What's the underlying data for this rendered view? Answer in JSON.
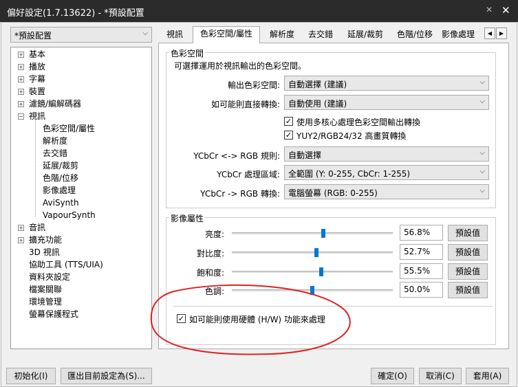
{
  "window": {
    "title": "偏好設定(1.7.13622) - *預設配置"
  },
  "profile": {
    "value": "*預設配置"
  },
  "tree": {
    "items": [
      "基本",
      "播放",
      "字幕",
      "裝置",
      "濾鏡/編解碼器",
      "視訊",
      "色彩空間/屬性",
      "解析度",
      "去交錯",
      "延展/裁剪",
      "色階/位移",
      "影像處理",
      "AviSynth",
      "VapourSynth",
      "音訊",
      "擴充功能",
      "3D 視訊",
      "協助工具 (TTS/UIA)",
      "資料夾設定",
      "檔案關聯",
      "環境管理",
      "螢幕保護程式"
    ]
  },
  "tabs": [
    "視訊",
    "色彩空間/屬性",
    "解析度",
    "去交錯",
    "延展/裁剪",
    "色階/位移",
    "影像處理"
  ],
  "colorspace": {
    "title": "色彩空間",
    "desc": "可選擇運用於視訊輸出的色彩空間。",
    "output_label": "輸出色彩空間:",
    "output_value": "自動選擇 (建議)",
    "direct_label": "如可能則直接轉換:",
    "direct_value": "自動使用 (建議)",
    "multicore_label": "使用多核心處理色彩空間輸出轉換",
    "yuy2_label": "YUY2/RGB24/32 高畫質轉換",
    "rule_label": "YCbCr <-> RGB 規則:",
    "rule_value": "自動選擇",
    "range_label": "YCbCr 處理區域:",
    "range_value": "全範圍 (Y: 0-255, CbCr: 1-255)",
    "convert_label": "YCbCr -> RGB 轉換:",
    "convert_value": "電腦螢幕 (RGB: 0-255)"
  },
  "image_props": {
    "title": "影像屬性",
    "default_label": "預設值",
    "brightness_label": "亮度:",
    "brightness_value": "56.8%",
    "brightness_level": 0.568,
    "contrast_label": "對比度:",
    "contrast_value": "52.7%",
    "contrast_level": 0.527,
    "saturation_label": "飽和度:",
    "saturation_value": "55.5%",
    "saturation_level": 0.555,
    "hue_label": "色調:",
    "hue_value": "50.0%",
    "hue_level": 0.5,
    "hw_label": "如可能則使用硬體 (H/W) 功能來處理"
  },
  "footer": {
    "init_label": "初始化(I)",
    "export_label": "匯出目前設定為(S)...",
    "ok_label": "確定(O)",
    "cancel_label": "取消(C)",
    "apply_label": "套用(A)"
  }
}
